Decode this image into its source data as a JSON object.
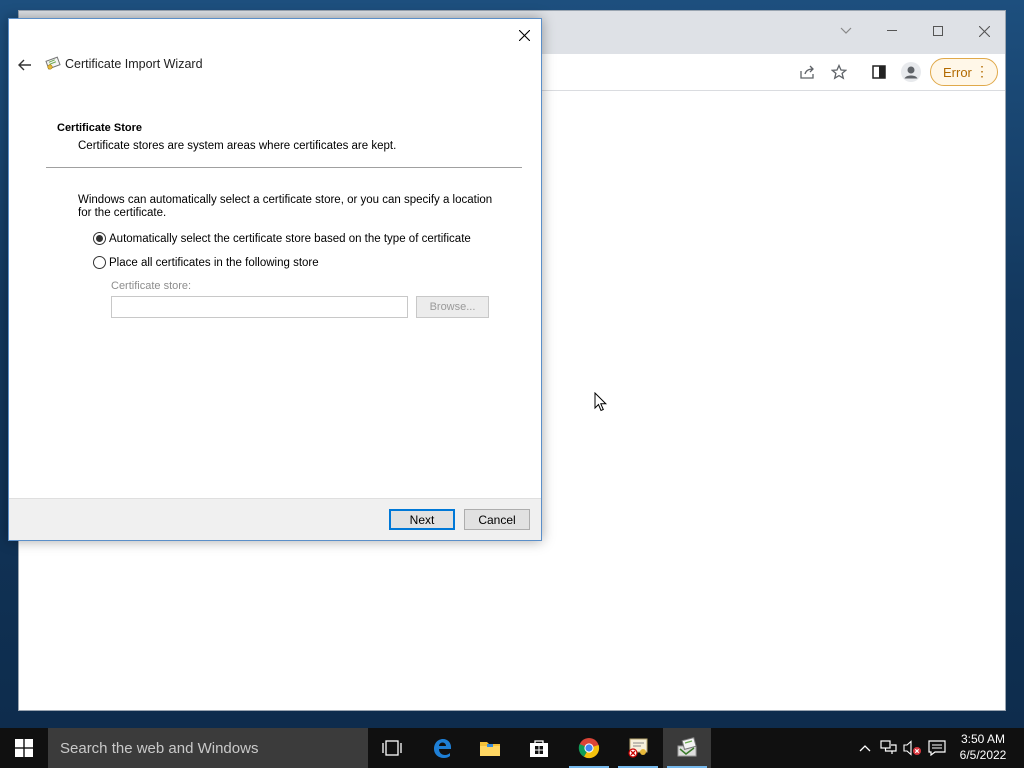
{
  "browser": {
    "error_badge": "Error",
    "icons": [
      "share-icon",
      "star-icon",
      "sidebar-icon",
      "profile-icon",
      "menu-dots-icon"
    ]
  },
  "dialog": {
    "title": "Certificate Import Wizard",
    "section_title": "Certificate Store",
    "section_desc": "Certificate stores are system areas where certificates are kept.",
    "intro": "Windows can automatically select a certificate store, or you can specify a location for the certificate.",
    "options": [
      {
        "label": "Automatically select the certificate store based on the type of certificate",
        "checked": true
      },
      {
        "label": "Place all certificates in the following store",
        "checked": false
      }
    ],
    "store_label": "Certificate store:",
    "store_value": "",
    "browse_label": "Browse...",
    "next_label": "Next",
    "cancel_label": "Cancel"
  },
  "taskbar": {
    "search_placeholder": "Search the web and Windows",
    "time": "3:50 AM",
    "date": "6/5/2022"
  },
  "colors": {
    "accent": "#0078d7",
    "error": "#b26a00",
    "taskbar": "#101010"
  }
}
